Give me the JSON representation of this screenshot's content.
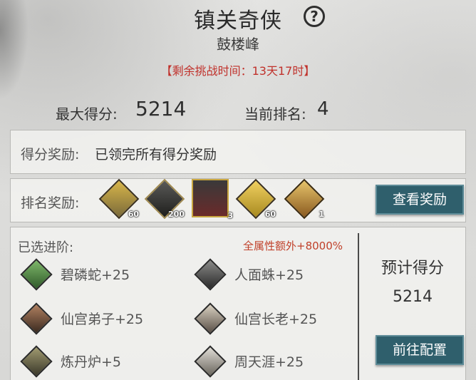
{
  "header": {
    "title": "镇关奇侠",
    "help_icon": "question-circle-icon",
    "subtitle": "鼓楼峰",
    "timer": "【剩余挑战时间：13天17时】"
  },
  "stats": {
    "max_score_label": "最大得分:",
    "max_score_value": "5214",
    "rank_label": "当前排名:",
    "rank_value": "4"
  },
  "score_reward": {
    "label": "得分奖励:",
    "text": "已领完所有得分奖励"
  },
  "rank_reward": {
    "label": "排名奖励:",
    "items": [
      {
        "icon": "arrow-bundle-icon",
        "count": "60"
      },
      {
        "icon": "dark-scroll-icon",
        "count": "200"
      },
      {
        "icon": "hero-portrait-icon",
        "count": "3"
      },
      {
        "icon": "gold-book-icon",
        "count": "60"
      },
      {
        "icon": "gold-token-icon",
        "count": "1"
      }
    ],
    "button": "查看奖励"
  },
  "advancement": {
    "label": "已选进阶:",
    "bonus": "全属性额外+8000%",
    "units": [
      {
        "name": "碧磷蛇+25",
        "icon": "green-snake-icon"
      },
      {
        "name": "人面蛛+25",
        "icon": "spider-icon"
      },
      {
        "name": "仙宫弟子+25",
        "icon": "disciple-portrait-icon"
      },
      {
        "name": "仙宫长老+25",
        "icon": "elder-portrait-icon"
      },
      {
        "name": "炼丹炉+5",
        "icon": "furnace-icon"
      },
      {
        "name": "周天涯+25",
        "icon": "old-man-portrait-icon"
      }
    ]
  },
  "estimate": {
    "label": "预计得分",
    "value": "5214",
    "button": "前往配置"
  },
  "colors": {
    "accent_red": "#c0312b",
    "button_teal": "#2f5f6c"
  }
}
